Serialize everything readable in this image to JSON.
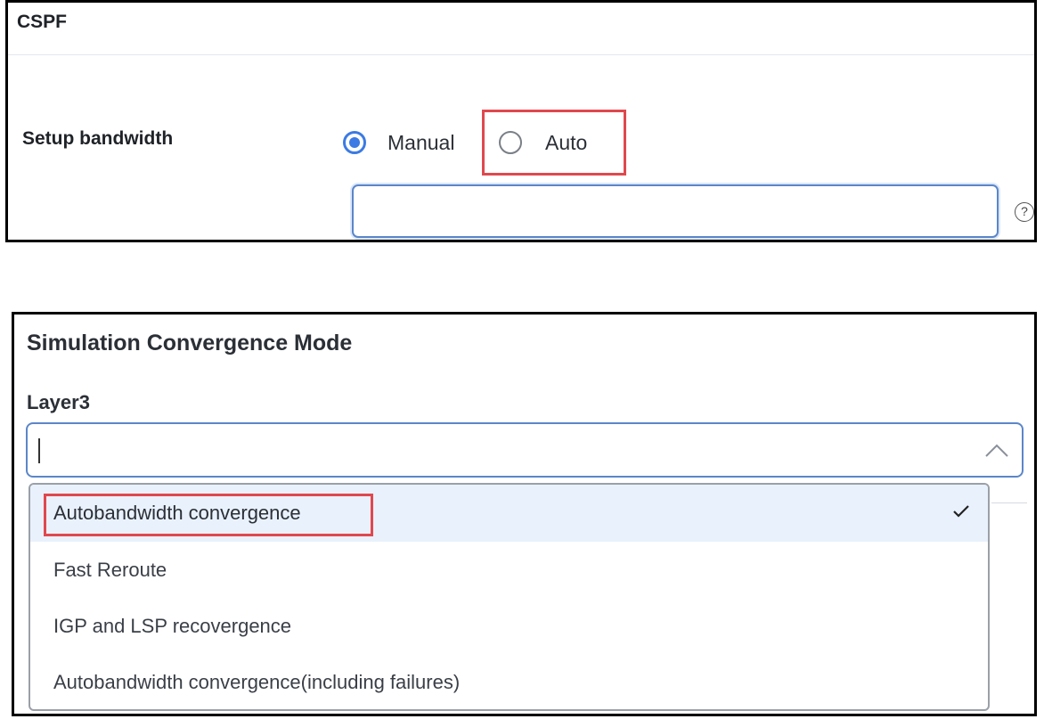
{
  "cspf": {
    "title": "CSPF",
    "setup_bandwidth_label": "Setup bandwidth",
    "radio_manual_label": "Manual",
    "radio_auto_label": "Auto",
    "selected_mode": "Manual",
    "bandwidth_value": "",
    "help_icon_glyph": "?"
  },
  "simulation": {
    "title": "Simulation Convergence Mode",
    "layer_label": "Layer3",
    "input_value": "",
    "options": [
      "Autobandwidth convergence",
      "Fast Reroute",
      "IGP and LSP recovergence",
      "Autobandwidth convergence(including failures)"
    ],
    "selected_option": "Autobandwidth convergence"
  },
  "colors": {
    "accent": "#3b7be3",
    "highlight_box": "#e0484e",
    "selected_option_bg": "#e9f1fc"
  },
  "icons": {
    "help": "question-circle-icon",
    "dropdown": "chevron-up-icon",
    "selected": "check-icon"
  }
}
